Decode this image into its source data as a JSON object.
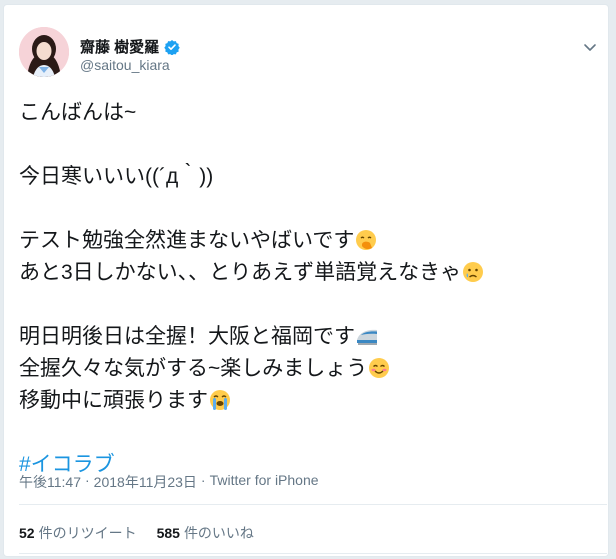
{
  "user": {
    "display_name": "齋藤 樹愛羅",
    "handle": "@saitou_kiara",
    "verified": true
  },
  "tweet": {
    "lines": [
      "こんばんは~",
      "",
      "今日寒いいい((´д｀))",
      "",
      "テスト勉強全然進まないやばいです",
      "あと3日しかない、、とりあえず単語覚えなきゃ",
      "",
      "明日明後日は全握！大阪と福岡です",
      "全握久々な気がする~楽しみましょう",
      "移動中に頑張ります",
      ""
    ],
    "emojis": [
      "face-with-hand-over-mouth",
      "crying-face",
      "bullet-train",
      "smiling-face",
      "loudly-crying-face"
    ],
    "hashtag": "#イコラブ"
  },
  "meta": {
    "time": "午後11:47",
    "separator": "·",
    "date": "2018年11月23日",
    "source": "Twitter for iPhone"
  },
  "stats": {
    "retweets_count": "52",
    "retweets_label": "件のリツイート",
    "likes_count": "585",
    "likes_label": "件のいいね"
  },
  "colors": {
    "link": "#1b95e0",
    "secondary_text": "#657786",
    "verified_badge": "#1da1f2"
  }
}
